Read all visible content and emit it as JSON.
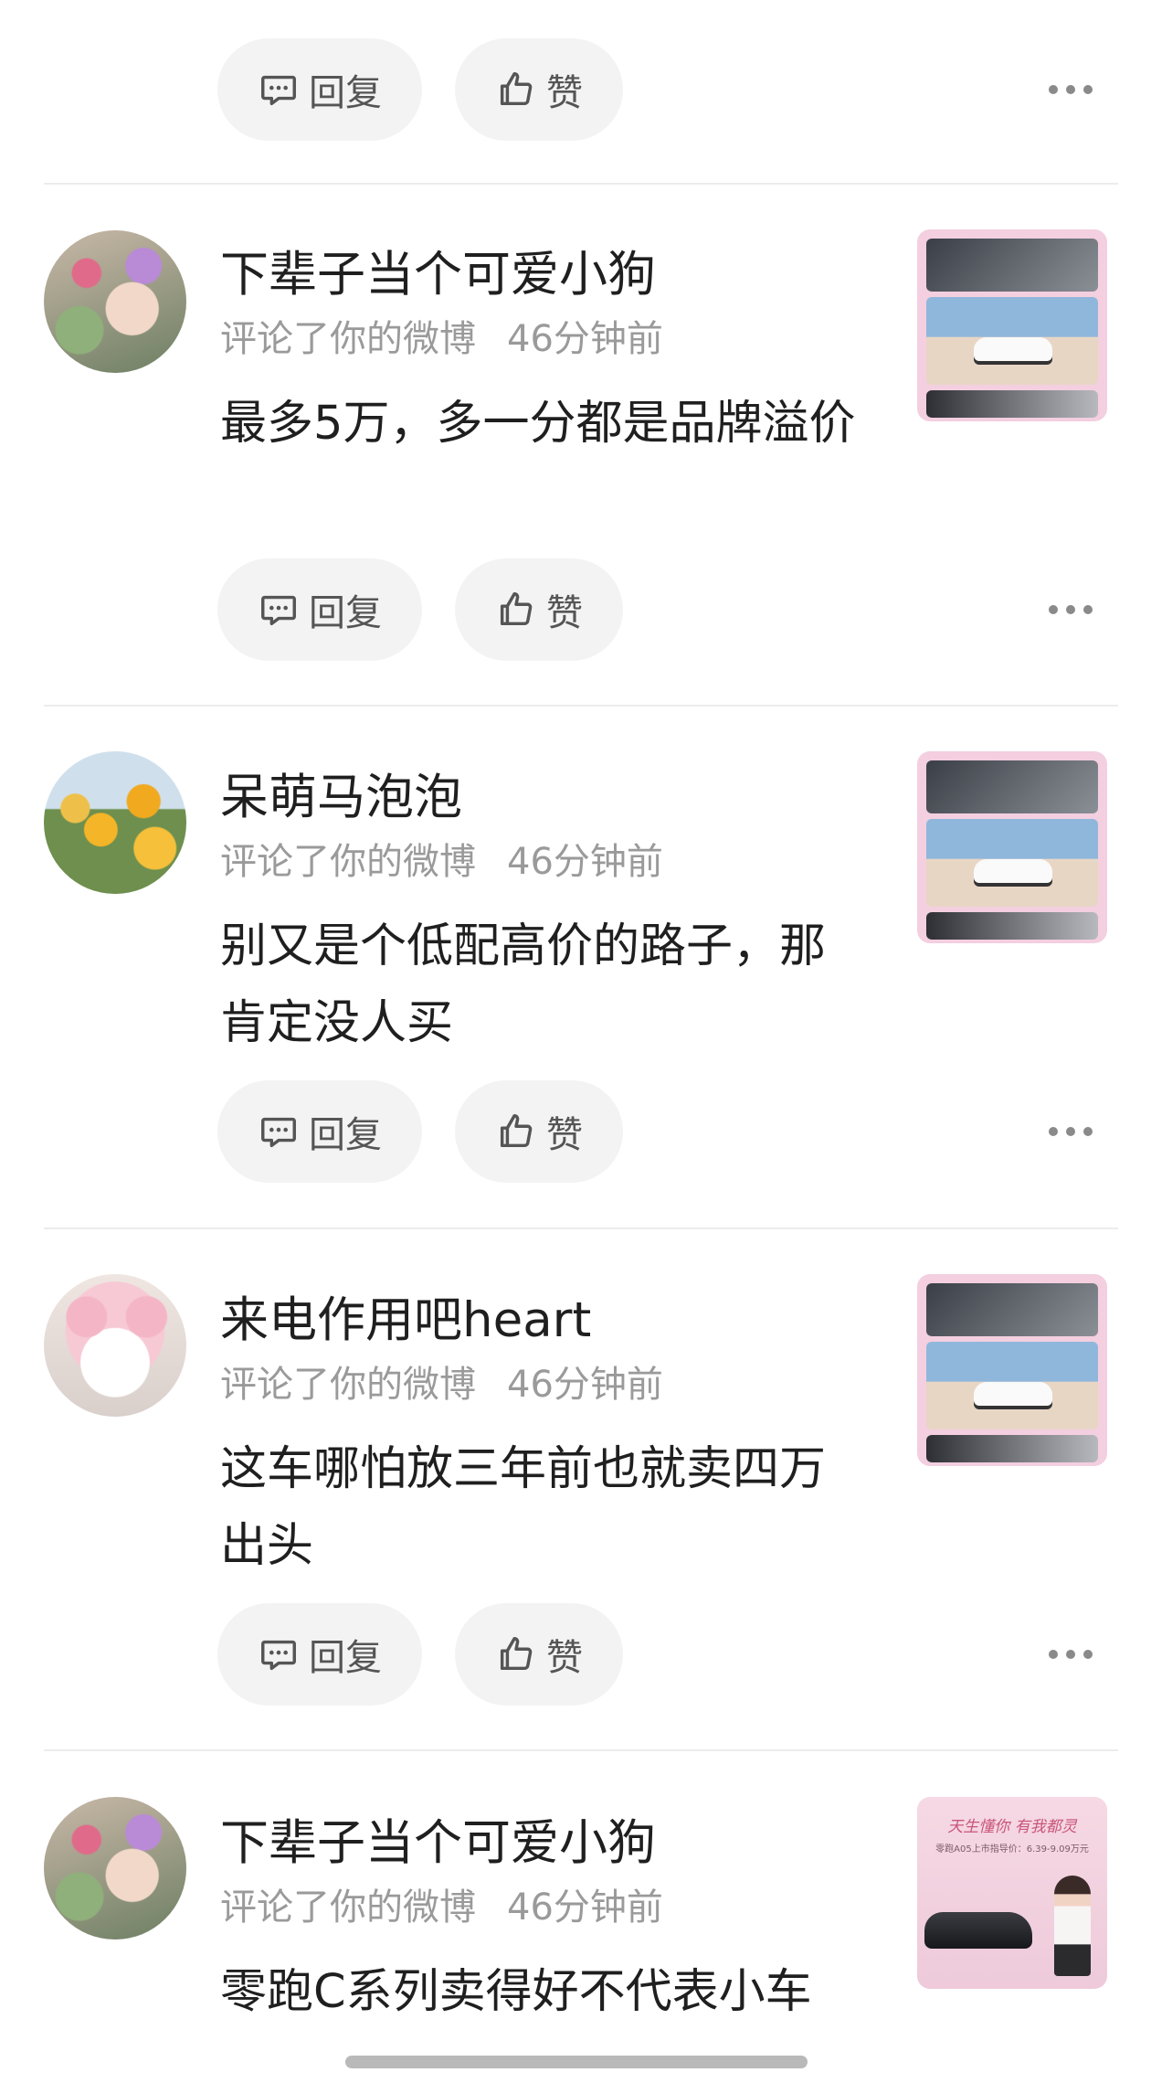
{
  "actions": {
    "reply_label": "回复",
    "like_label": "赞"
  },
  "comments": [
    {
      "username": "下辈子当个可爱小狗",
      "action": "评论了你的微博",
      "time": "46分钟前",
      "text": "最多5万，多一分都是品牌溢价"
    },
    {
      "username": "呆萌马泡泡",
      "action": "评论了你的微博",
      "time": "46分钟前",
      "text": "别又是个低配高价的路子，那肯定没人买"
    },
    {
      "username": "来电作用吧heart",
      "action": "评论了你的微博",
      "time": "46分钟前",
      "text": "这车哪怕放三年前也就卖四万出头"
    },
    {
      "username": "下辈子当个可爱小狗",
      "action": "评论了你的微博",
      "time": "46分钟前",
      "text": "零跑C系列卖得好不代表小车"
    }
  ],
  "thumb_promo": {
    "headline": "天生懂你 有我都灵",
    "price_line": "零跑A05上市指导价：6.39-9.09万元"
  },
  "icons": [
    "comment-icon",
    "thumbs-up-icon",
    "more-icon"
  ],
  "colors": {
    "pill_bg": "#f3f3f3",
    "meta_gray": "#9a9a9a",
    "thumb_pink": "#f3cfe0"
  }
}
